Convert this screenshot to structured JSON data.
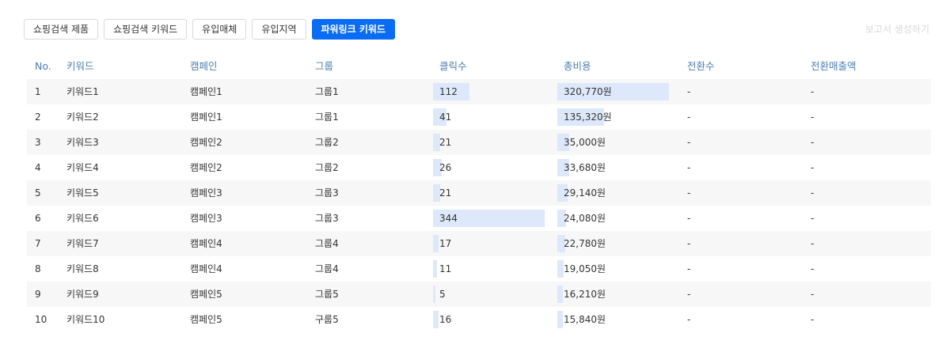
{
  "tabs": [
    {
      "label": "쇼핑검색 제품",
      "active": false
    },
    {
      "label": "쇼핑검색 키워드",
      "active": false
    },
    {
      "label": "유입매체",
      "active": false
    },
    {
      "label": "유입지역",
      "active": false
    },
    {
      "label": "파워링크 키워드",
      "active": true
    }
  ],
  "report_link": "보고서 생성하기",
  "table": {
    "headers": [
      "No.",
      "키워드",
      "캠페인",
      "그룹",
      "클릭수",
      "총비용",
      "전환수",
      "전환매출액"
    ],
    "clicks_max": 344,
    "cost_max": 320770,
    "rows": [
      {
        "no": "1",
        "keyword": "키워드1",
        "campaign": "캠페인1",
        "group": "그룹1",
        "clicks": 112,
        "clicks_label": "112",
        "cost": 320770,
        "cost_label": "320,770원",
        "conversions": "-",
        "revenue": "-"
      },
      {
        "no": "2",
        "keyword": "키워드2",
        "campaign": "캠페인1",
        "group": "그룹1",
        "clicks": 41,
        "clicks_label": "41",
        "cost": 135320,
        "cost_label": "135,320원",
        "conversions": "-",
        "revenue": "-"
      },
      {
        "no": "3",
        "keyword": "키워드3",
        "campaign": "캠페인2",
        "group": "그룹2",
        "clicks": 21,
        "clicks_label": "21",
        "cost": 35000,
        "cost_label": "35,000원",
        "conversions": "-",
        "revenue": "-"
      },
      {
        "no": "4",
        "keyword": "키워드4",
        "campaign": "캠페인2",
        "group": "그룹2",
        "clicks": 26,
        "clicks_label": "26",
        "cost": 33680,
        "cost_label": "33,680원",
        "conversions": "-",
        "revenue": "-"
      },
      {
        "no": "5",
        "keyword": "키워드5",
        "campaign": "캠페인3",
        "group": "그룹3",
        "clicks": 21,
        "clicks_label": "21",
        "cost": 29140,
        "cost_label": "29,140원",
        "conversions": "-",
        "revenue": "-"
      },
      {
        "no": "6",
        "keyword": "키워드6",
        "campaign": "캠페인3",
        "group": "그룹3",
        "clicks": 344,
        "clicks_label": "344",
        "cost": 24080,
        "cost_label": "24,080원",
        "conversions": "-",
        "revenue": "-"
      },
      {
        "no": "7",
        "keyword": "키워드7",
        "campaign": "캠페인4",
        "group": "그룹4",
        "clicks": 17,
        "clicks_label": "17",
        "cost": 22780,
        "cost_label": "22,780원",
        "conversions": "-",
        "revenue": "-"
      },
      {
        "no": "8",
        "keyword": "키워드8",
        "campaign": "캠페인4",
        "group": "그룹4",
        "clicks": 11,
        "clicks_label": "11",
        "cost": 19050,
        "cost_label": "19,050원",
        "conversions": "-",
        "revenue": "-"
      },
      {
        "no": "9",
        "keyword": "키워드9",
        "campaign": "캠페인5",
        "group": "그룹5",
        "clicks": 5,
        "clicks_label": "5",
        "cost": 16210,
        "cost_label": "16,210원",
        "conversions": "-",
        "revenue": "-"
      },
      {
        "no": "10",
        "keyword": "키워드10",
        "campaign": "캠페인5",
        "group": "구룹5",
        "clicks": 16,
        "clicks_label": "16",
        "cost": 15840,
        "cost_label": "15,840원",
        "conversions": "-",
        "revenue": "-"
      }
    ]
  },
  "colors": {
    "accent": "#0a6cf5",
    "header_text": "#4a7fb0",
    "bar_fill": "#dde8fb",
    "stripe": "#f7f7f7"
  }
}
